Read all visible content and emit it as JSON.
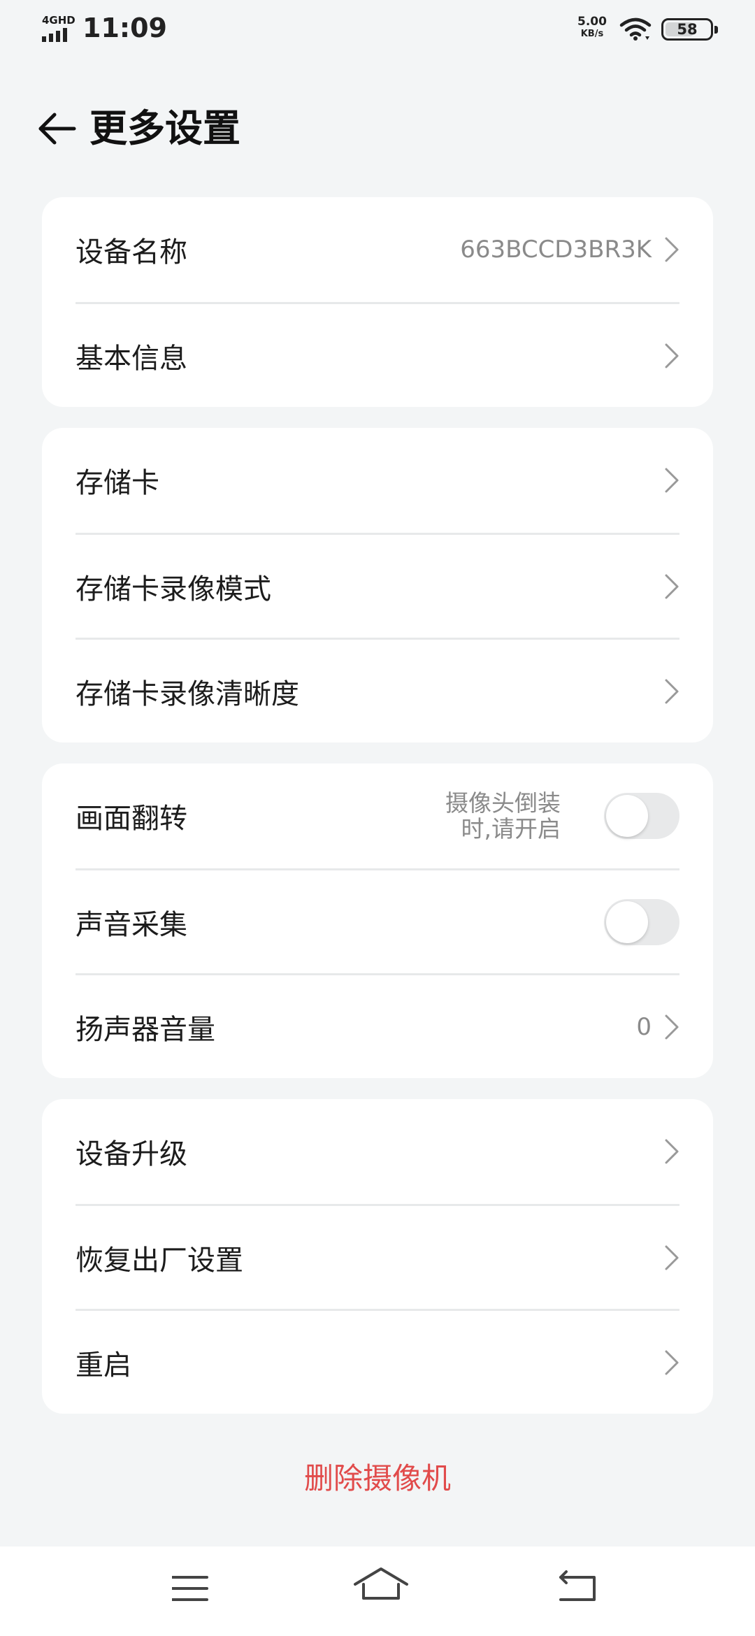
{
  "status_bar": {
    "network": "4GHD",
    "time": "11:09",
    "speed_value": "5.00",
    "speed_unit": "KB/s",
    "battery": "58"
  },
  "header": {
    "title": "更多设置",
    "back_icon": "arrow-left-icon"
  },
  "groups": [
    {
      "rows": [
        {
          "label": "设备名称",
          "value": "663BCCD3BR3K",
          "type": "chevron"
        },
        {
          "label": "基本信息",
          "value": "",
          "type": "chevron"
        }
      ]
    },
    {
      "rows": [
        {
          "label": "存储卡",
          "value": "",
          "type": "chevron"
        },
        {
          "label": "存储卡录像模式",
          "value": "",
          "type": "chevron"
        },
        {
          "label": "存储卡录像清晰度",
          "value": "",
          "type": "chevron"
        }
      ]
    },
    {
      "rows": [
        {
          "label": "画面翻转",
          "hint_line1": "摄像头倒装",
          "hint_line2": "时,请开启",
          "type": "toggle",
          "on": false
        },
        {
          "label": "声音采集",
          "type": "toggle",
          "on": false
        },
        {
          "label": "扬声器音量",
          "value": "0",
          "type": "chevron"
        }
      ]
    },
    {
      "rows": [
        {
          "label": "设备升级",
          "value": "",
          "type": "chevron"
        },
        {
          "label": "恢复出厂设置",
          "value": "",
          "type": "chevron"
        },
        {
          "label": "重启",
          "value": "",
          "type": "chevron"
        }
      ]
    }
  ],
  "delete_label": "删除摄像机",
  "colors": {
    "background": "#f3f5f6",
    "card": "#ffffff",
    "danger": "#e14b4b",
    "secondary_text": "#8a8a8a"
  },
  "nav_bar": {
    "items": [
      "menu-icon",
      "home-icon",
      "back-icon"
    ]
  }
}
